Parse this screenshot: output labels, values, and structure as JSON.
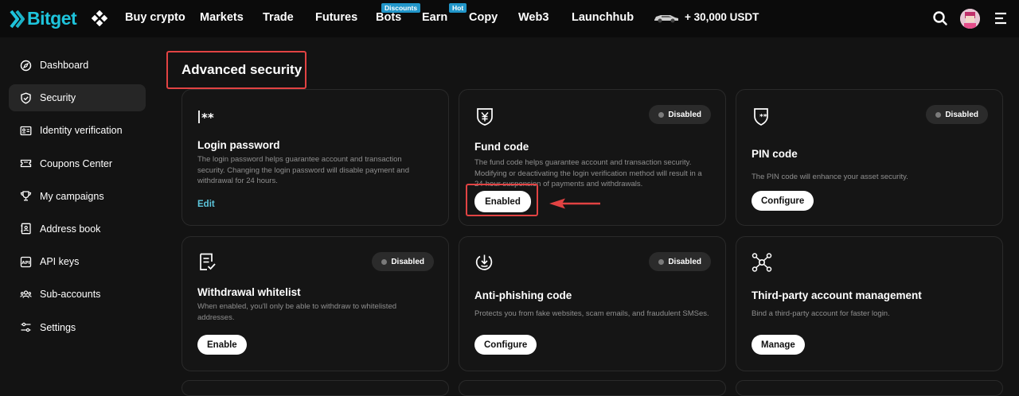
{
  "header": {
    "logo_text": "Bitget",
    "nav": [
      {
        "label": "Buy crypto"
      },
      {
        "label": "Markets"
      },
      {
        "label": "Trade"
      },
      {
        "label": "Futures"
      },
      {
        "label": "Bots",
        "badge": "Discounts"
      },
      {
        "label": "Earn",
        "badge": "Hot"
      },
      {
        "label": "Copy"
      },
      {
        "label": "Web3"
      },
      {
        "label": "Launchhub"
      }
    ],
    "promo_text": "+ 30,000 USDT"
  },
  "sidebar": {
    "items": [
      {
        "label": "Dashboard",
        "icon": "compass-icon"
      },
      {
        "label": "Security",
        "icon": "shield-icon",
        "active": true
      },
      {
        "label": "Identity verification",
        "icon": "id-card-icon"
      },
      {
        "label": "Coupons Center",
        "icon": "coupon-icon"
      },
      {
        "label": "My campaigns",
        "icon": "trophy-icon"
      },
      {
        "label": "Address book",
        "icon": "address-book-icon"
      },
      {
        "label": "API keys",
        "icon": "api-key-icon"
      },
      {
        "label": "Sub-accounts",
        "icon": "users-icon"
      },
      {
        "label": "Settings",
        "icon": "sliders-icon"
      }
    ]
  },
  "main": {
    "section_title": "Advanced security",
    "cards": {
      "login_password": {
        "title": "Login password",
        "description": "The login password helps guarantee account and transaction security. Changing the login password will disable payment and withdrawal for 24 hours.",
        "action": "Edit"
      },
      "fund_code": {
        "title": "Fund code",
        "status": "Disabled",
        "description": "The fund code helps guarantee account and transaction security. Modifying or deactivating the login verification method will result in a 24-hour suspension of payments and withdrawals.",
        "action": "Enabled"
      },
      "pin_code": {
        "title": "PIN code",
        "status": "Disabled",
        "description": "The PIN code will enhance your asset security.",
        "action": "Configure"
      },
      "withdrawal_whitelist": {
        "title": "Withdrawal whitelist",
        "status": "Disabled",
        "description": "When enabled, you'll only be able to withdraw to whitelisted addresses.",
        "action": "Enable"
      },
      "anti_phishing": {
        "title": "Anti-phishing code",
        "status": "Disabled",
        "description": "Protects you from fake websites, scam emails, and fraudulent SMSes.",
        "action": "Configure"
      },
      "third_party": {
        "title": "Third-party account management",
        "description": "Bind a third-party account for faster login.",
        "action": "Manage"
      }
    }
  },
  "colors": {
    "accent": "#1ec4dc",
    "annotation_red": "#e24343",
    "background": "#131313"
  }
}
